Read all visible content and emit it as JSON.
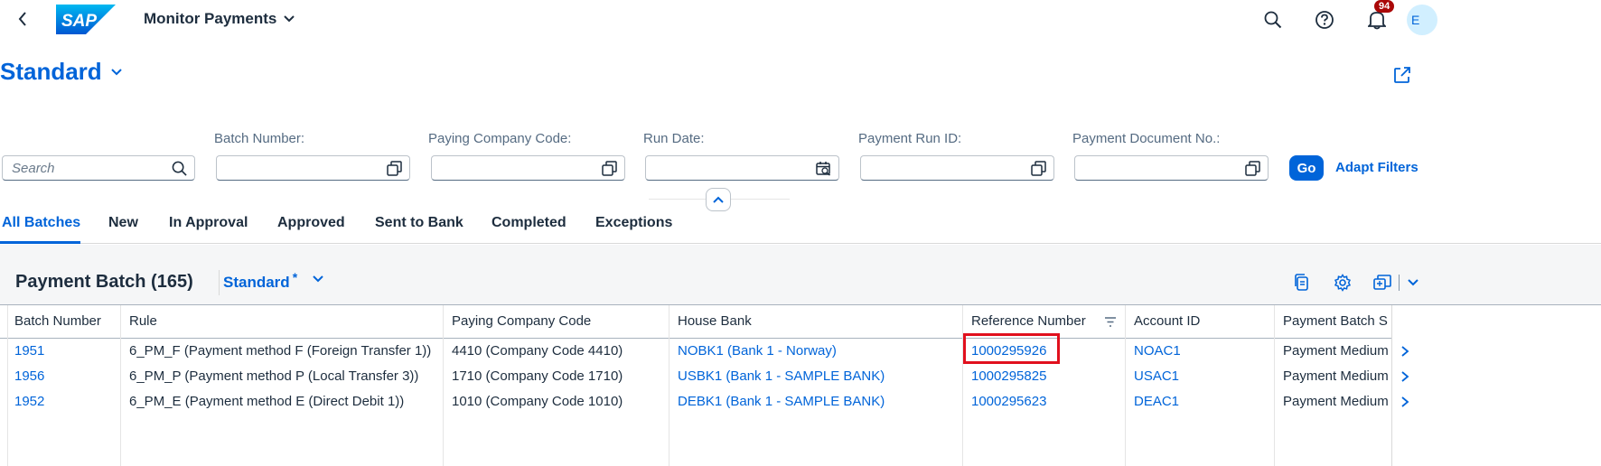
{
  "shell": {
    "title": "Monitor Payments",
    "logo_text": "SAP",
    "notification_count": "94",
    "avatar_initial": "E",
    "icons": [
      "back-icon",
      "search-icon",
      "help-icon",
      "bell-icon"
    ]
  },
  "variant": {
    "name": "Standard"
  },
  "filters": {
    "search_placeholder": "Search",
    "fields": [
      {
        "label": "Batch Number:",
        "value": ""
      },
      {
        "label": "Paying Company Code:",
        "value": ""
      },
      {
        "label": "Run Date:",
        "value": ""
      },
      {
        "label": "Payment Run ID:",
        "value": ""
      },
      {
        "label": "Payment Document No.:",
        "value": ""
      }
    ],
    "go_label": "Go",
    "adapt_label": "Adapt Filters"
  },
  "tabs": [
    "All Batches",
    "New",
    "In Approval",
    "Approved",
    "Sent to Bank",
    "Completed",
    "Exceptions"
  ],
  "active_tab": "All Batches",
  "table": {
    "title": "Payment Batch (165)",
    "variant": "Standard",
    "variant_modified": "*",
    "columns": [
      "Batch Number",
      "Rule",
      "Paying Company Code",
      "House Bank",
      "Reference Number",
      "Account ID",
      "Payment Batch S"
    ],
    "rows": [
      {
        "batch": "1951",
        "rule": "6_PM_F (Payment method F (Foreign Transfer 1))",
        "company": "4410 (Company Code 4410)",
        "bank": "NOBK1 (Bank 1 - Norway)",
        "reference": "1000295926",
        "account": "NOAC1",
        "status": "Payment Medium"
      },
      {
        "batch": "1956",
        "rule": "6_PM_P (Payment method P (Local Transfer 3))",
        "company": "1710 (Company Code 1710)",
        "bank": "USBK1 (Bank 1 - SAMPLE BANK)",
        "reference": "1000295825",
        "account": "USAC1",
        "status": "Payment Medium"
      },
      {
        "batch": "1952",
        "rule": "6_PM_E (Payment method E (Direct Debit 1))",
        "company": "1010 (Company Code 1010)",
        "bank": "DEBK1 (Bank 1 - SAMPLE BANK)",
        "reference": "1000295623",
        "account": "DEAC1",
        "status": "Payment Medium"
      }
    ]
  },
  "colors": {
    "accent": "#0064d9",
    "highlight": "#e1101d",
    "badge": "#aa0808"
  }
}
